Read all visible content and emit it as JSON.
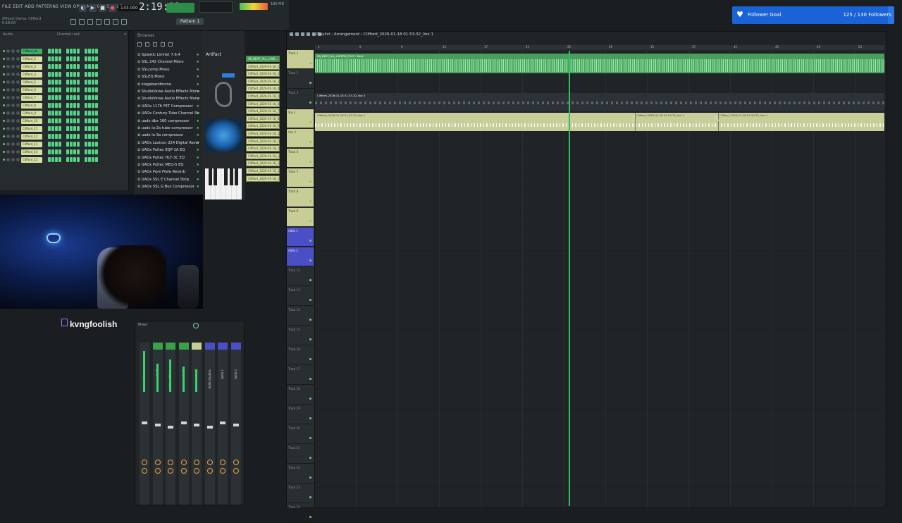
{
  "topbar": {
    "menu": "FILE EDIT ADD PATTERNS VIEW OPTIONS TOOLS HELP",
    "song_info": "(Mixer) Demo: Clifford",
    "song_time": "0:18:00",
    "tempo": "133.000",
    "clock": "2:19:92",
    "pattern": "Pattern 1",
    "cpu_label": "180 MB"
  },
  "channel_rack": {
    "header_left": "Audio",
    "header_mid": "Channel rack",
    "channels": [
      {
        "name": "Clifford_Vo",
        "selected": true
      },
      {
        "name": "Clifford_2",
        "selected": false
      },
      {
        "name": "Clifford_3",
        "selected": false
      },
      {
        "name": "Clifford_4",
        "selected": false
      },
      {
        "name": "Clifford_5",
        "selected": false
      },
      {
        "name": "Clifford_6",
        "selected": false
      },
      {
        "name": "Clifford_7",
        "selected": false
      },
      {
        "name": "Clifford_8",
        "selected": false
      },
      {
        "name": "Clifford_9",
        "selected": false
      },
      {
        "name": "Clifford_10",
        "selected": false
      },
      {
        "name": "Clifford_11",
        "selected": false
      },
      {
        "name": "Clifford_12",
        "selected": false
      },
      {
        "name": "Clifford_13",
        "selected": false
      },
      {
        "name": "Clifford_14",
        "selected": false
      },
      {
        "name": "Clifford_15",
        "selected": false
      }
    ]
  },
  "browser": {
    "title": "Browser",
    "items": [
      "Splastic Limiter 7.6.4",
      "SSL 242 Channel Mono",
      "SSLcomp Mono",
      "SSLEQ Mono",
      "stagebandmono",
      "StudioVerse Audio Effects Mono",
      "StudioVerse Audio Effects Mono-Stereo",
      "UADx 1176 FET Compressor",
      "UADx Century Tube Channel Strip",
      "uadx dbx 160 compressor",
      "uadx la-2a tube compressor",
      "uadx la-3a compressor",
      "UADx Lexicon 224 Digital Reverb",
      "UADx Pultec EQP-1A EQ",
      "UADx Pultec HLF-3C EQ",
      "UADx Pultec MEQ-5 EQ",
      "UADx Pure Plate Reverb",
      "UADx SSL E Channel Strip",
      "UADx SSL G Bus Compressor"
    ]
  },
  "midpanel": {
    "tab": "Artifact",
    "clips": [
      "SB_BEAT_ALL_LAYE...",
      "Clifford_2026-01-18_1",
      "Clifford_2026-01-18_2",
      "Clifford_2026-01-18_3",
      "Clifford_2026-01-18_4",
      "Clifford_2026-01-18_5",
      "Clifford_2026-01-18_6",
      "Clifford_2026-01-18_7",
      "Clifford_2026-01-18_8",
      "Clifford_2026-01-18_9",
      "Clifford_2026-01-18_10",
      "Clifford_2026-01-18_11",
      "Clifford_2026-01-18_12",
      "Clifford_2026-01-18_13",
      "Clifford_2026-01-18_14",
      "Clifford_2026-01-18_15",
      "Clifford_2026-01-18_16"
    ]
  },
  "stream": {
    "handle": "kvngfoolish"
  },
  "mixer": {
    "header": "Mixer",
    "strips": [
      {
        "name": "Master",
        "color": "#2b3134"
      },
      {
        "name": "BEAT",
        "color": "#3aa04a"
      },
      {
        "name": "Vocal Chain",
        "color": "#3aa04a"
      },
      {
        "name": "Vox 1",
        "color": "#3aa04a"
      },
      {
        "name": "Vox 2",
        "color": "#c8cd96"
      },
      {
        "name": "Adlib Doubles",
        "color": "#4b4fc6"
      },
      {
        "name": "Adlib 1",
        "color": "#4b4fc6"
      },
      {
        "name": "Adlib 2",
        "color": "#4b4fc6"
      }
    ]
  },
  "playlist": {
    "title": "Playlist - Arrangement › Clifford_2026-01-18 01-53-32_Vox 1",
    "ruler": [
      "1",
      "5",
      "9",
      "13",
      "17",
      "21",
      "25",
      "29",
      "33",
      "37",
      "41",
      "45",
      "49",
      "53"
    ],
    "tracks": [
      {
        "name": "Track 1",
        "style": "yellow"
      },
      {
        "name": "Track 2",
        "style": "plain"
      },
      {
        "name": "Track 3",
        "style": "plain"
      },
      {
        "name": "Vox 1",
        "style": "yellow"
      },
      {
        "name": "Vox 2",
        "style": "yellow"
      },
      {
        "name": "Track 6",
        "style": "yellow"
      },
      {
        "name": "Track 7",
        "style": "yellow"
      },
      {
        "name": "Track 8",
        "style": "yellow"
      },
      {
        "name": "Track 9",
        "style": "yellow"
      },
      {
        "name": "Adlib 1",
        "style": "blue"
      },
      {
        "name": "Adlib 2",
        "style": "blue"
      },
      {
        "name": "Track 12",
        "style": "plain"
      },
      {
        "name": "Track 13",
        "style": "plain"
      },
      {
        "name": "Track 14",
        "style": "plain"
      },
      {
        "name": "Track 15",
        "style": "plain"
      },
      {
        "name": "Track 16",
        "style": "plain"
      },
      {
        "name": "Track 17",
        "style": "plain"
      },
      {
        "name": "Track 18",
        "style": "plain"
      },
      {
        "name": "Track 19",
        "style": "plain"
      },
      {
        "name": "Track 20",
        "style": "plain"
      },
      {
        "name": "Track 21",
        "style": "plain"
      },
      {
        "name": "Track 22",
        "style": "plain"
      },
      {
        "name": "Track 23",
        "style": "plain"
      },
      {
        "name": "Track 24",
        "style": "plain"
      }
    ],
    "clip_beat": "SB_BEAT_ALL_LAYERS_PLUS - Beat",
    "clip_track3": "Clifford_2026-01-18 01-53-32_Vox 3",
    "clip_vox1_a": "Clifford_2026-01-18 01-53-32_Vox 1",
    "clip_vox1_b": "Clifford_2026-01-18 01-53-32_Vox 1",
    "clip_vox1_c": "Clifford_2026-01-18 01-53-32_Vox 1"
  },
  "goal": {
    "label": "Follower Goal",
    "count": "125 / 130 Followers",
    "current": 125,
    "target": 130,
    "accent": "#1a63d6"
  }
}
